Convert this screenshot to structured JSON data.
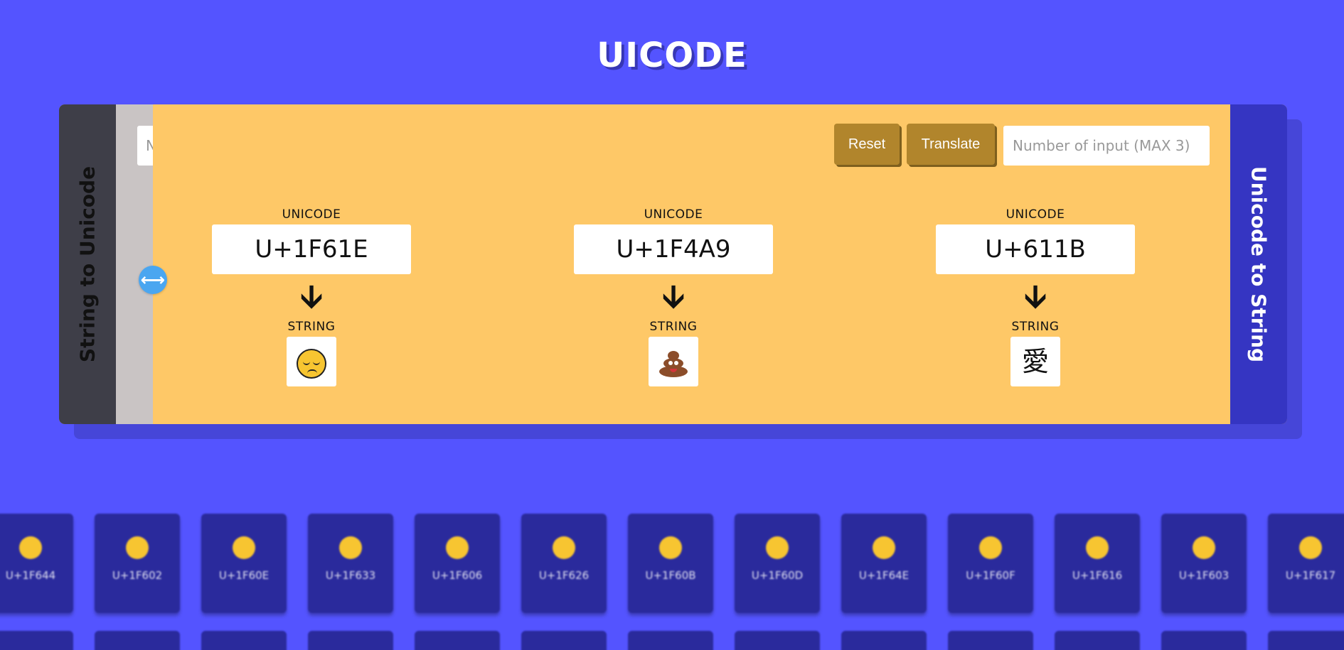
{
  "app": {
    "title": "UICODE"
  },
  "panel": {
    "left_label": "String to Unicode",
    "right_label": "Unicode to String",
    "left_input_placeholder": "N",
    "reset_label": "Reset",
    "translate_label": "Translate",
    "number_input_placeholder": "Number of input (MAX 3)",
    "slider_icon": "horizontal-arrows-icon"
  },
  "results": [
    {
      "unicode_label": "UNICODE",
      "code": "U+1F61E",
      "arrow": "🡫",
      "string_label": "STRING",
      "char": "😞"
    },
    {
      "unicode_label": "UNICODE",
      "code": "U+1F4A9",
      "arrow": "🡫",
      "string_label": "STRING",
      "char": "💩"
    },
    {
      "unicode_label": "UNICODE",
      "code": "U+611B",
      "arrow": "🡫",
      "string_label": "STRING",
      "char": "愛"
    }
  ],
  "tiles": [
    {
      "code": "U+1F644",
      "icon": "eye-roll-emoji-icon"
    },
    {
      "code": "U+1F602",
      "icon": "tears-of-joy-emoji-icon"
    },
    {
      "code": "U+1F60E",
      "icon": "sunglasses-emoji-icon"
    },
    {
      "code": "U+1F633",
      "icon": "flushed-emoji-icon"
    },
    {
      "code": "U+1F606",
      "icon": "laughing-emoji-icon"
    },
    {
      "code": "U+1F626",
      "icon": "frowning-emoji-icon"
    },
    {
      "code": "U+1F60B",
      "icon": "yum-emoji-icon"
    },
    {
      "code": "U+1F60D",
      "icon": "heart-eyes-emoji-icon"
    },
    {
      "code": "U+1F64E",
      "icon": "person-pouting-emoji-icon"
    },
    {
      "code": "U+1F60F",
      "icon": "smirk-emoji-icon"
    },
    {
      "code": "U+1F616",
      "icon": "confounded-emoji-icon"
    },
    {
      "code": "U+1F603",
      "icon": "grinning-emoji-icon"
    },
    {
      "code": "U+1F617",
      "icon": "kissing-emoji-icon"
    }
  ]
}
